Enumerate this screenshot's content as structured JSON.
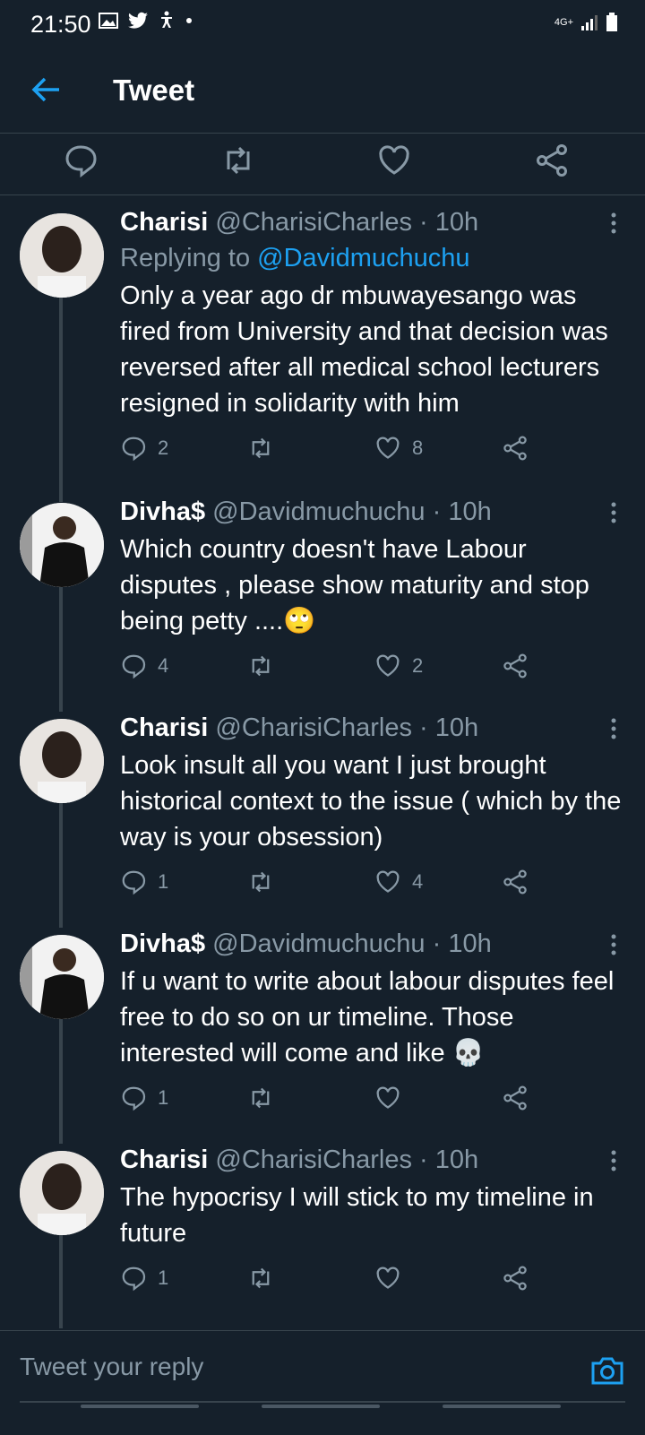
{
  "status_bar": {
    "time": "21:50",
    "network": "4G+",
    "icons": [
      "gallery-icon",
      "twitter-bird-icon",
      "accessibility-icon",
      "dot-icon"
    ]
  },
  "header": {
    "title": "Tweet",
    "back_icon": "arrow-left-icon"
  },
  "colors": {
    "background": "#15202b",
    "accent": "#1da1f2",
    "muted": "#8899a6",
    "divider": "#38444d"
  },
  "tweets": [
    {
      "name": "Charisi",
      "meta": "@CharisiCharles · 10h",
      "replying_prefix": "Replying to ",
      "replying_handle": "@Davidmuchuchu",
      "text": "Only a year ago dr mbuwayesango was fired from University and that decision was reversed after all medical school lecturers resigned in solidarity with him",
      "replies": "2",
      "likes": "8"
    },
    {
      "name": "Divha$",
      "meta": "@Davidmuchuchu · 10h",
      "text": "Which country doesn't have Labour disputes , please show maturity and stop being petty ....🙄",
      "replies": "4",
      "likes": "2"
    },
    {
      "name": "Charisi",
      "meta": "@CharisiCharles · 10h",
      "text": "Look insult all you want I just brought historical context to the issue ( which by the way is your obsession)",
      "replies": "1",
      "likes": "4"
    },
    {
      "name": "Divha$",
      "meta": "@Davidmuchuchu · 10h",
      "text": "If u want to write about labour disputes feel free to do so on ur timeline. Those interested will come and like 💀",
      "replies": "1",
      "likes": ""
    },
    {
      "name": "Charisi",
      "meta": "@CharisiCharles · 10h",
      "text": "The hypocrisy I will stick to my timeline in future",
      "replies": "1",
      "likes": ""
    }
  ],
  "composer": {
    "placeholder": "Tweet your reply"
  }
}
